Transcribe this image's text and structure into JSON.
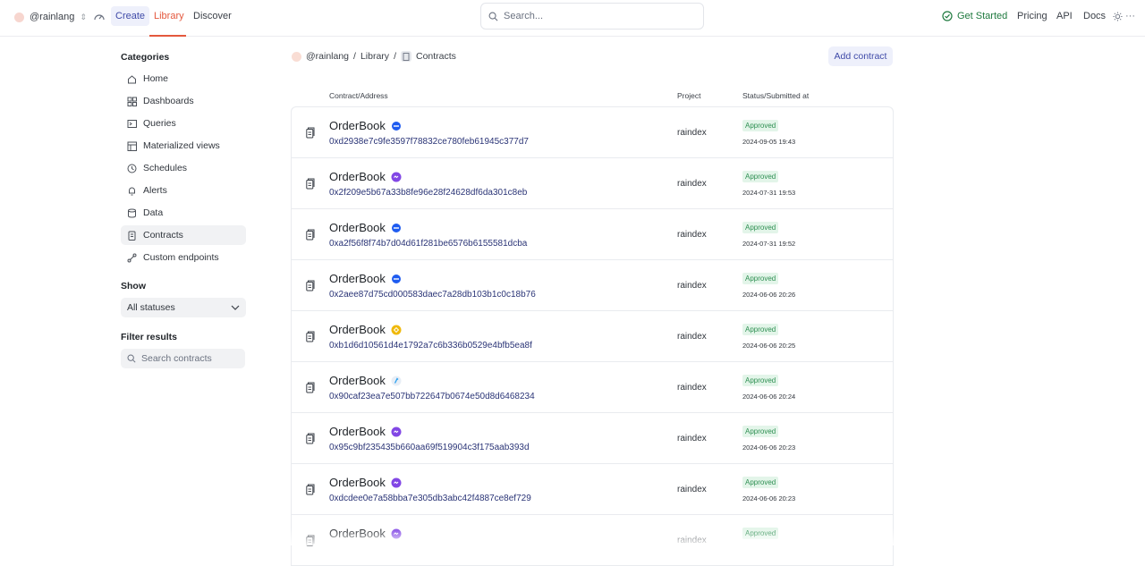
{
  "topnav": {
    "username": "@rainlang",
    "tabs": [
      "Create",
      "Library",
      "Discover"
    ],
    "search_placeholder": "Search...",
    "get_started": "Get Started",
    "links": [
      "Pricing",
      "API",
      "Docs"
    ],
    "more": "···",
    "accent_color": "#e4583d"
  },
  "sidebar": {
    "categories_title": "Categories",
    "items": [
      {
        "label": "Home",
        "icon": "home-icon"
      },
      {
        "label": "Dashboards",
        "icon": "dashboard-icon"
      },
      {
        "label": "Queries",
        "icon": "query-icon"
      },
      {
        "label": "Materialized views",
        "icon": "layers-icon"
      },
      {
        "label": "Schedules",
        "icon": "clock-icon"
      },
      {
        "label": "Alerts",
        "icon": "bell-icon"
      },
      {
        "label": "Data",
        "icon": "database-icon"
      },
      {
        "label": "Contracts",
        "icon": "contract-icon",
        "active": true
      },
      {
        "label": "Custom endpoints",
        "icon": "endpoint-icon"
      }
    ],
    "show_title": "Show",
    "show_value": "All statuses",
    "filter_title": "Filter results",
    "filter_placeholder": "Search contracts"
  },
  "breadcrumb": {
    "user": "@rainlang",
    "sep1": "/",
    "library": "Library",
    "sep2": "/",
    "page": "Contracts"
  },
  "add_contract_label": "Add contract",
  "table": {
    "headers": {
      "contract": "Contract/Address",
      "project": "Project",
      "status": "Status/Submitted at"
    },
    "rows": [
      {
        "name": "OrderBook",
        "chain": "base",
        "chain_color": "#1f5cf0",
        "address": "0xd2938e7c9fe3597f78832ce780feb61945c377d7",
        "project": "raindex",
        "status": "Approved",
        "date": "2024-09-05 19:43"
      },
      {
        "name": "OrderBook",
        "chain": "polygon",
        "chain_color": "#8247e5",
        "address": "0x2f209e5b67a33b8fe96e28f24628df6da301c8eb",
        "project": "raindex",
        "status": "Approved",
        "date": "2024-07-31 19:53"
      },
      {
        "name": "OrderBook",
        "chain": "base",
        "chain_color": "#1f5cf0",
        "address": "0xa2f56f8f74b7d04d61f281be6576b6155581dcba",
        "project": "raindex",
        "status": "Approved",
        "date": "2024-07-31 19:52"
      },
      {
        "name": "OrderBook",
        "chain": "base",
        "chain_color": "#1f5cf0",
        "address": "0x2aee87d75cd000583daec7a28db103b1c0c18b76",
        "project": "raindex",
        "status": "Approved",
        "date": "2024-06-06 20:26"
      },
      {
        "name": "OrderBook",
        "chain": "bnb",
        "chain_color": "#f0b90b",
        "address": "0xb1d6d10561d4e1792a7c6b336b0529e4bfb5ea8f",
        "project": "raindex",
        "status": "Approved",
        "date": "2024-06-06 20:25"
      },
      {
        "name": "OrderBook",
        "chain": "arbitrum",
        "chain_color": "#28a0f0",
        "address": "0x90caf23ea7e507bb722647b0674e50d8d6468234",
        "project": "raindex",
        "status": "Approved",
        "date": "2024-06-06 20:24"
      },
      {
        "name": "OrderBook",
        "chain": "polygon",
        "chain_color": "#8247e5",
        "address": "0x95c9bf235435b660aa69f519904c3f175aab393d",
        "project": "raindex",
        "status": "Approved",
        "date": "2024-06-06 20:23"
      },
      {
        "name": "OrderBook",
        "chain": "polygon",
        "chain_color": "#8247e5",
        "address": "0xdcdee0e7a58bba7e305db3abc42f4887ce8ef729",
        "project": "raindex",
        "status": "Approved",
        "date": "2024-06-06 20:23"
      },
      {
        "name": "OrderBook",
        "chain": "polygon",
        "chain_color": "#8247e5",
        "address": "",
        "project": "raindex",
        "status": "Approved",
        "date": ""
      }
    ]
  }
}
